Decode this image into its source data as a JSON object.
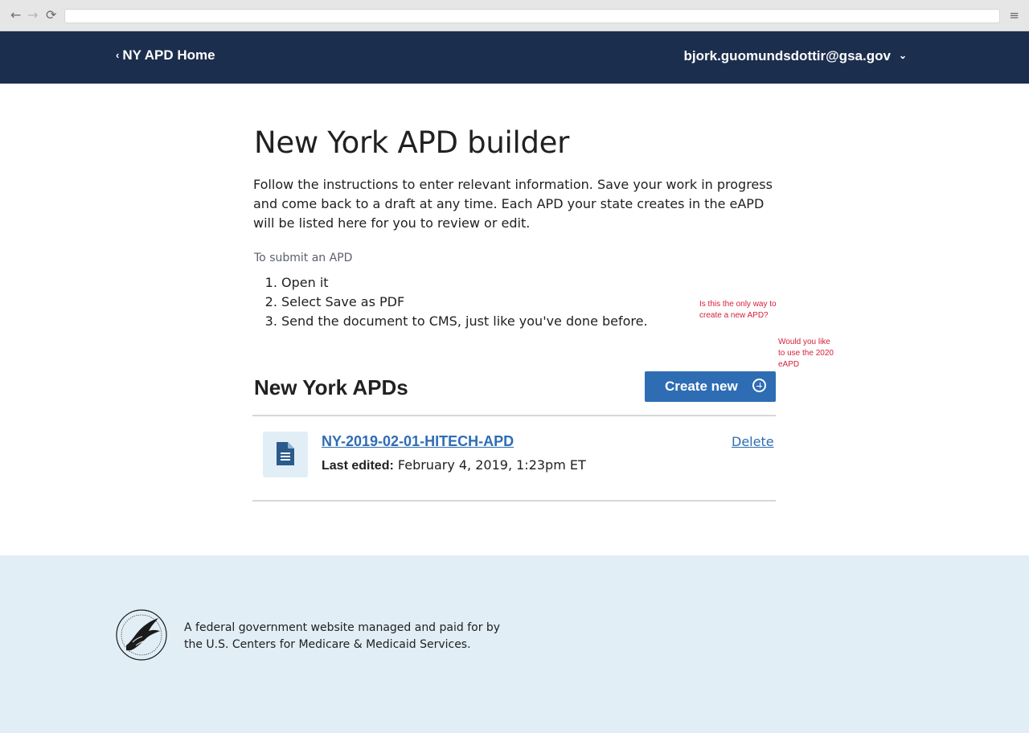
{
  "browser": {
    "back_glyph": "←",
    "forward_glyph": "→",
    "reload_glyph": "⟳",
    "menu_glyph": "≡",
    "url": ""
  },
  "header": {
    "home_chevron": "‹",
    "home_label": "NY APD Home",
    "user_email": "bjork.guomundsdottir@gsa.gov",
    "user_caret": "⌄",
    "background_color": "#1c2e4d"
  },
  "main": {
    "title": "New York APD builder",
    "intro": "Follow the instructions to enter relevant information. Save your work in progress and come back to a draft at any time. Each APD your state creates in the eAPD will be listed here for you to review or edit.",
    "submit_label": "To submit an APD",
    "steps": [
      "Open it",
      "Select Save as PDF",
      "Send the document to CMS, just like you've done before."
    ],
    "apds_heading": "New York APDs",
    "create_button_label": "Create new",
    "accent_color": "#2e6db4",
    "apds": [
      {
        "name": "NY-2019-02-01-HITECH-APD",
        "last_edited_label": "Last edited:",
        "last_edited_value": "February 4, 2019, 1:23pm ET",
        "delete_label": "Delete",
        "icon": "document-icon"
      }
    ]
  },
  "comments": {
    "comment_1": "Is this the only way to create a new APD?",
    "comment_2": "Would you like to use the 2020 eAPD",
    "color": "#d6203a"
  },
  "footer": {
    "logo": "hhs-eagle-logo",
    "text": "A federal government website managed and paid for by the U.S. Centers for Medicare & Medicaid Services.",
    "background_color": "#e1eef6"
  }
}
